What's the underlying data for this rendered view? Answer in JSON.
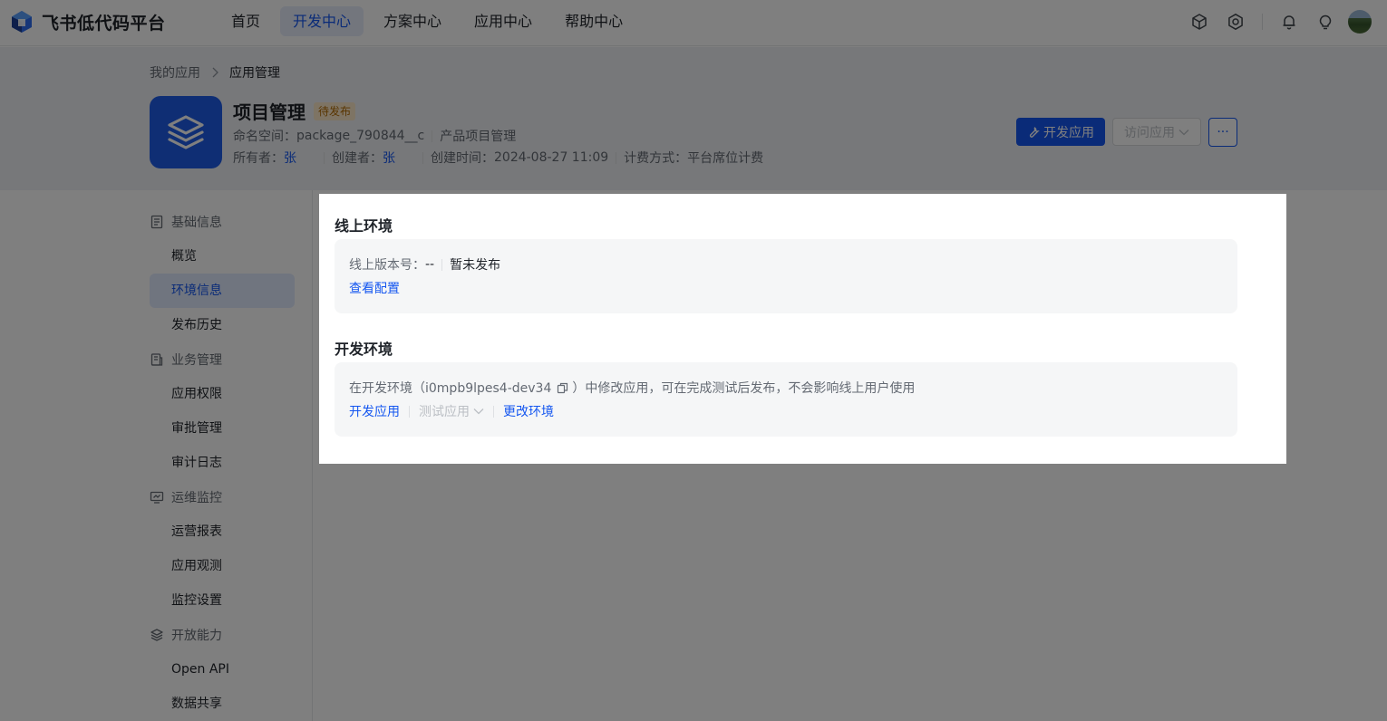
{
  "brand": {
    "name": "飞书低代码平台"
  },
  "nav": {
    "items": [
      {
        "label": "首页",
        "active": false
      },
      {
        "label": "开发中心",
        "active": true
      },
      {
        "label": "方案中心",
        "active": false
      },
      {
        "label": "应用中心",
        "active": false
      },
      {
        "label": "帮助中心",
        "active": false
      }
    ]
  },
  "top_actions": [
    "cube-icon",
    "gear-icon",
    "bell-icon",
    "lightbulb-icon",
    "avatar"
  ],
  "breadcrumb": {
    "parent": "我的应用",
    "current": "应用管理"
  },
  "app": {
    "title": "项目管理",
    "status": "待发布",
    "namespace_label": "命名空间：",
    "namespace": "package_790844__c",
    "category": "产品项目管理",
    "owner_label": "所有者：",
    "owner": "张",
    "creator_label": "创建者：",
    "creator": "张",
    "created_label": "创建时间：",
    "created_at": "2024-08-27 11:09",
    "billing_label": "计费方式：",
    "billing": "平台席位计费"
  },
  "header_buttons": {
    "develop": "开发应用",
    "visit": "访问应用",
    "more": "···"
  },
  "sidebar": {
    "groups": [
      {
        "label": "基础信息",
        "icon": "document-icon",
        "items": [
          "概览",
          "环境信息",
          "发布历史"
        ]
      },
      {
        "label": "业务管理",
        "icon": "briefcase-icon",
        "items": [
          "应用权限",
          "审批管理",
          "审计日志"
        ]
      },
      {
        "label": "运维监控",
        "icon": "monitor-icon",
        "items": [
          "运营报表",
          "应用观测",
          "监控设置"
        ]
      },
      {
        "label": "开放能力",
        "icon": "layers-icon",
        "items": [
          "Open API",
          "数据共享"
        ]
      }
    ],
    "active_item": "环境信息"
  },
  "online_env": {
    "title": "线上环境",
    "version_label": "线上版本号：",
    "version": "--",
    "status": "暂未发布",
    "view_config": "查看配置"
  },
  "dev_env": {
    "title": "开发环境",
    "desc_prefix": "在开发环境（i0mpb9lpes4-dev34",
    "desc_suffix": "）中修改应用，可在完成测试后发布，不会影响线上用户使用",
    "develop_link": "开发应用",
    "test_link": "测试应用",
    "change_env_link": "更改环境"
  },
  "colors": {
    "primary": "#1456f0",
    "nav_active_bg": "#e6edfb",
    "status_tag_bg": "#fde8c9",
    "status_tag_text": "#b26b00",
    "mask": "rgba(0,0,0,0.5)"
  }
}
